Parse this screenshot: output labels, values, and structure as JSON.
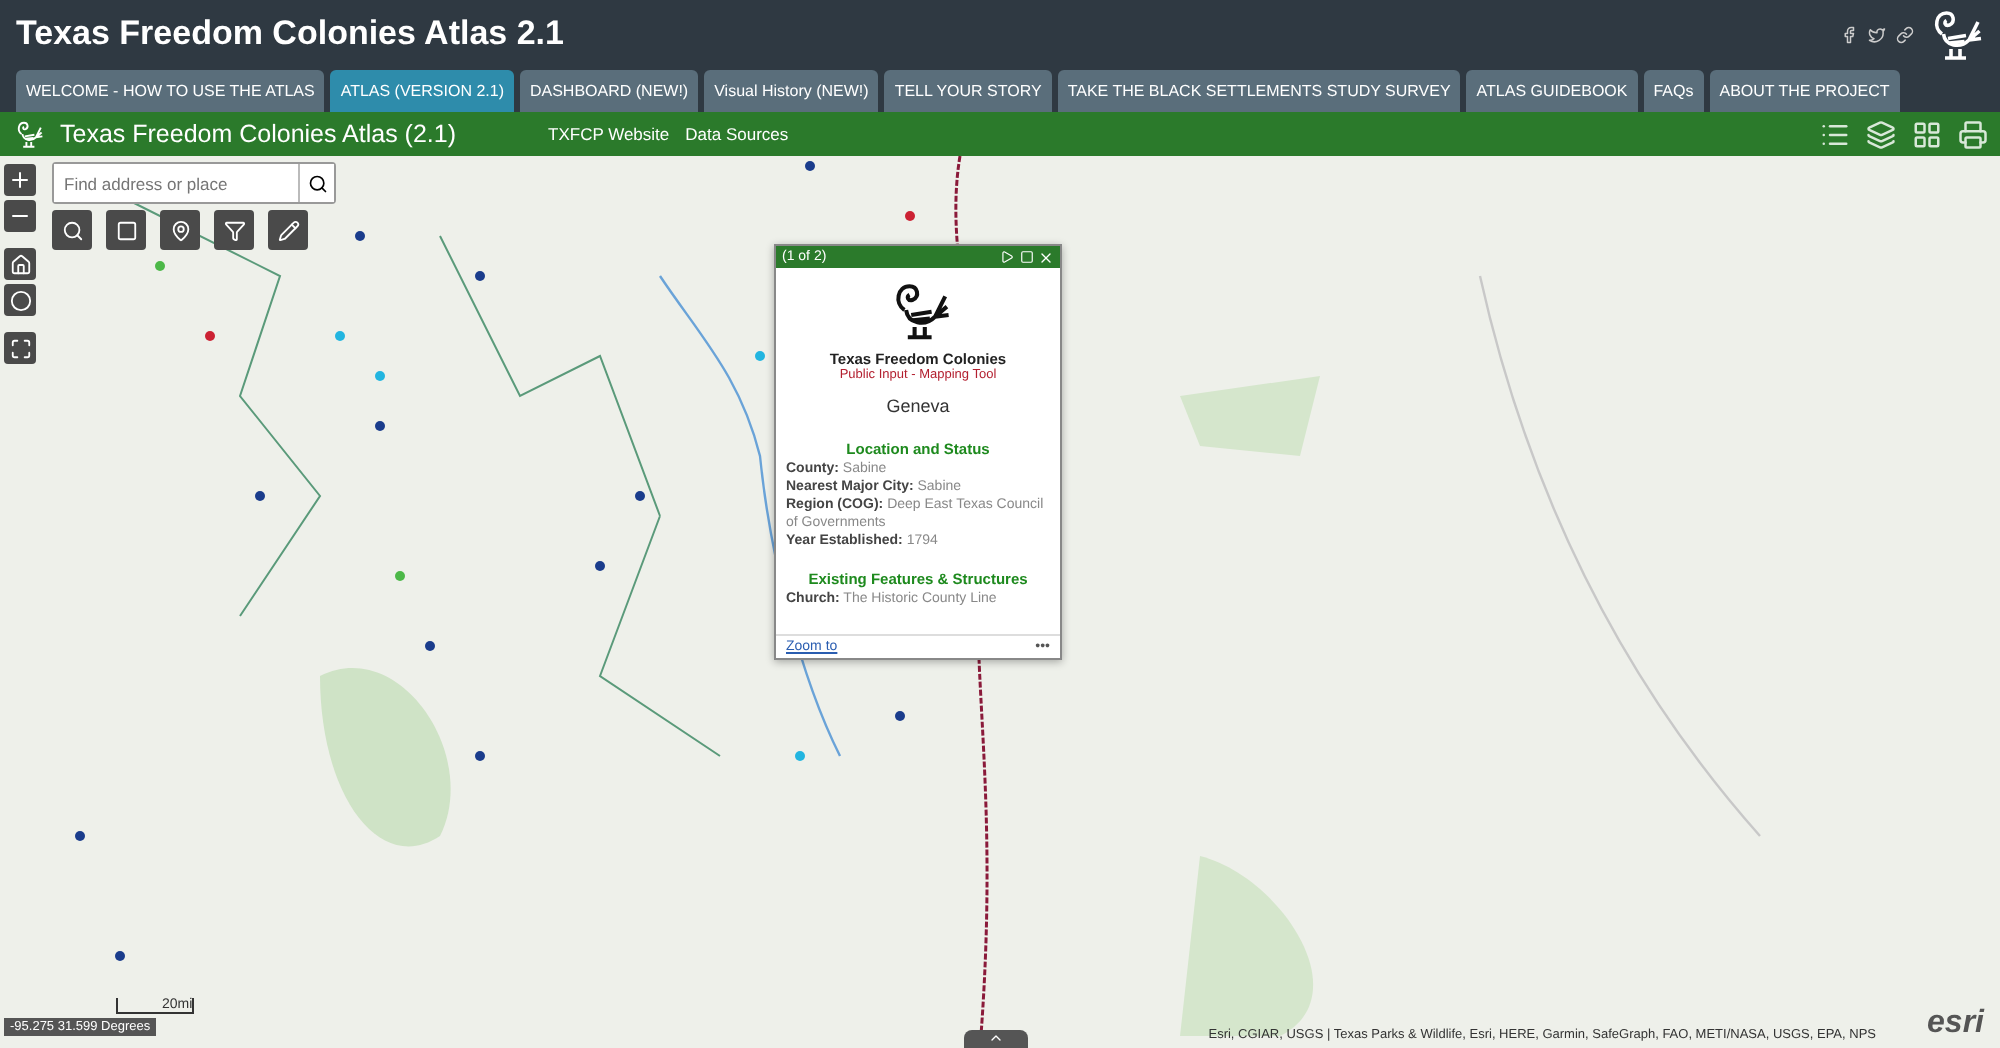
{
  "header": {
    "title": "Texas Freedom Colonies Atlas 2.1"
  },
  "tabs": [
    {
      "label": "WELCOME - HOW TO USE THE ATLAS",
      "selected": false
    },
    {
      "label": "ATLAS (VERSION 2.1)",
      "selected": true
    },
    {
      "label": "DASHBOARD (NEW!)",
      "selected": false
    },
    {
      "label": "Visual History (NEW!)",
      "selected": false
    },
    {
      "label": "TELL YOUR STORY",
      "selected": false
    },
    {
      "label": "TAKE THE BLACK SETTLEMENTS STUDY SURVEY",
      "selected": false
    },
    {
      "label": "ATLAS GUIDEBOOK",
      "selected": false
    },
    {
      "label": "FAQs",
      "selected": false
    },
    {
      "label": "ABOUT THE PROJECT",
      "selected": false
    }
  ],
  "app_bar": {
    "title": "Texas Freedom Colonies Atlas (2.1)",
    "links": [
      "TXFCP Website",
      "Data Sources"
    ]
  },
  "search": {
    "placeholder": "Find address or place"
  },
  "popup": {
    "counter": "(1 of 2)",
    "org": "Texas Freedom Colonies",
    "subtitle": "Public Input - Mapping Tool",
    "name": "Geneva",
    "sections": [
      {
        "heading": "Location and Status",
        "fields": [
          {
            "label": "County:",
            "value": "Sabine"
          },
          {
            "label": "Nearest Major City:",
            "value": "Sabine"
          },
          {
            "label": "Region (COG):",
            "value": "Deep East Texas Council of Governments"
          },
          {
            "label": "Year Established:",
            "value": "1794"
          }
        ]
      },
      {
        "heading": "Existing Features & Structures",
        "fields": [
          {
            "label": "Church:",
            "value": "The Historic County Line"
          }
        ]
      }
    ],
    "zoom_link": "Zoom to",
    "more": "•••"
  },
  "scale": "20mi",
  "coordinates": "-95.275 31.599 Degrees",
  "attribution": "Esri, CGIAR, USGS | Texas Parks & Wildlife, Esri, HERE, Garmin, SafeGraph, FAO, METI/NASA, USGS, EPA, NPS",
  "logo": "esri"
}
